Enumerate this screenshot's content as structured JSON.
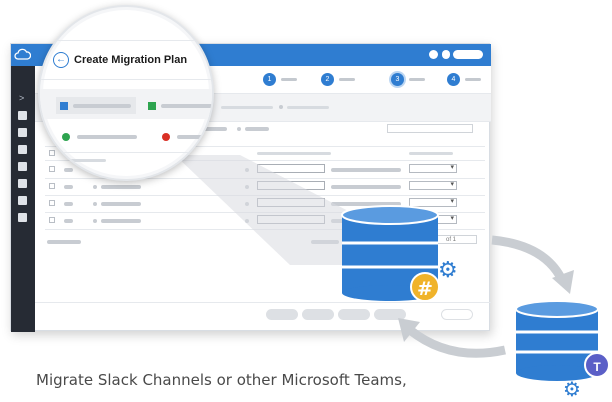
{
  "dialog": {
    "title": "Create Migration Plan"
  },
  "steps": [
    "1",
    "2",
    "3",
    "4"
  ],
  "pager": {
    "of_label": "of 1"
  },
  "caption": "Migrate Slack Channels or other Microsoft Teams,",
  "colors": {
    "brand_blue": "#2f7dd1",
    "slack_badge": "#f0b32a",
    "teams_badge": "#5b5fc7",
    "status_green": "#2ea44f",
    "status_red": "#d93025"
  },
  "icons": {
    "slack_glyph": "#",
    "teams_glyph": "T",
    "back_glyph": "←",
    "gear_glyph": "⚙"
  }
}
